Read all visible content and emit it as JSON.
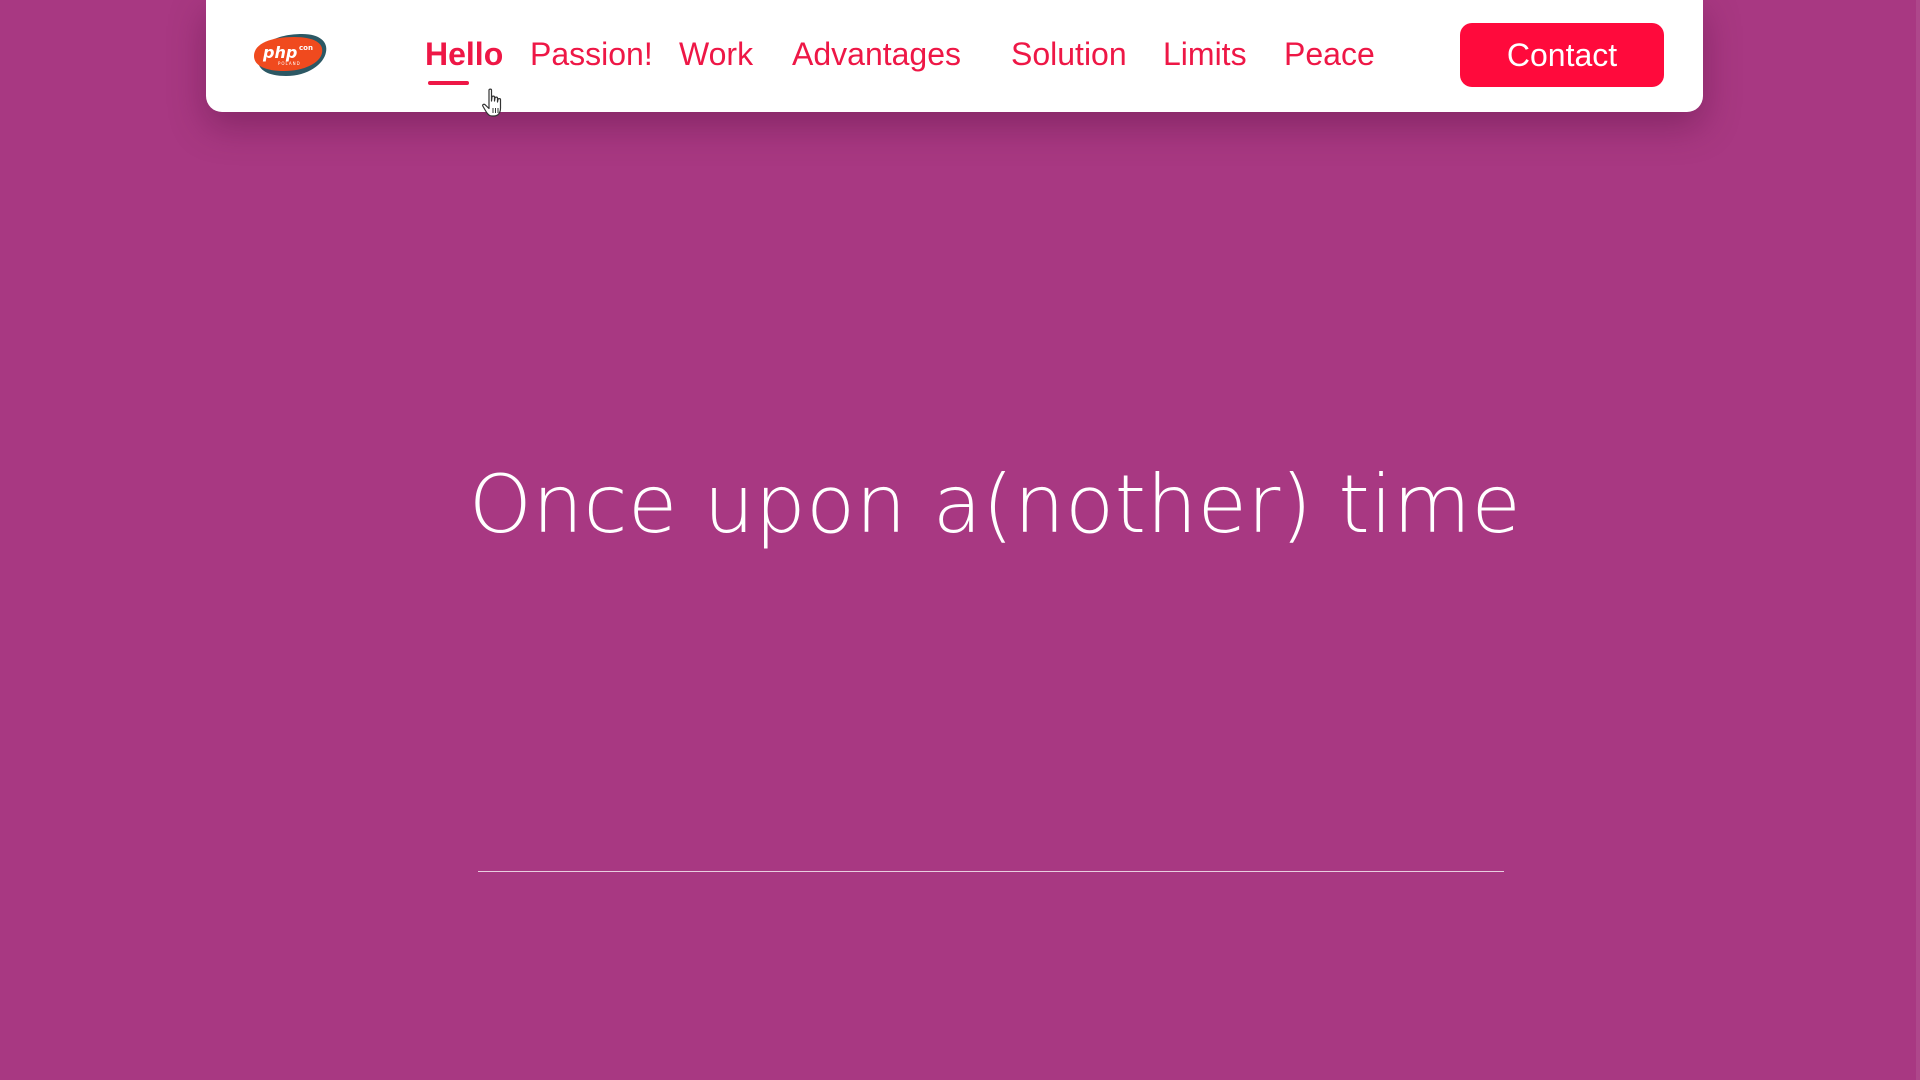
{
  "nav": {
    "logo": {
      "icon": "phpcon-poland-logo",
      "text": "php",
      "superscript": "con",
      "subtext": "POLAND"
    },
    "items": [
      {
        "label": "Hello",
        "active": true
      },
      {
        "label": "Passion!",
        "active": false
      },
      {
        "label": "Work",
        "active": false
      },
      {
        "label": "Advantages",
        "active": false
      },
      {
        "label": "Solution",
        "active": false
      },
      {
        "label": "Limits",
        "active": false
      },
      {
        "label": "Peace",
        "active": false
      }
    ],
    "contact_label": "Contact"
  },
  "hero": {
    "title": "Once upon a(nother) time"
  },
  "colors": {
    "background": "#a83882",
    "accent": "#ee1746",
    "button": "#ff0a3c",
    "text_light": "#ffffff"
  }
}
